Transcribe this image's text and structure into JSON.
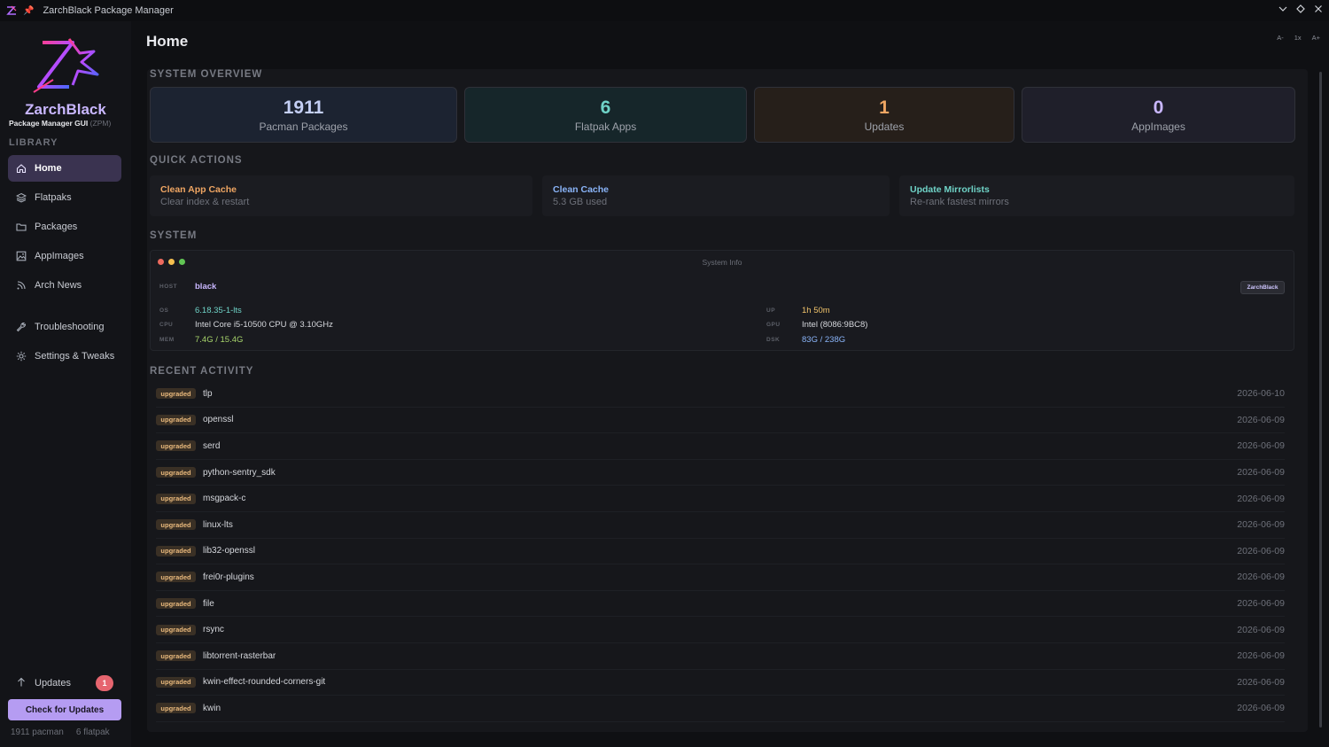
{
  "window": {
    "title": "ZarchBlack Package Manager",
    "controls": [
      "minimize",
      "maximize",
      "close"
    ]
  },
  "sidebar": {
    "brand": "ZarchBlack",
    "subtitle": "Package Manager GUI",
    "subtitle_tag": "(ZPM)",
    "library_heading": "LIBRARY",
    "nav": [
      {
        "label": "Home",
        "icon": "home-icon",
        "active": true
      },
      {
        "label": "Flatpaks",
        "icon": "layers-icon",
        "active": false
      },
      {
        "label": "Packages",
        "icon": "folder-icon",
        "active": false
      },
      {
        "label": "AppImages",
        "icon": "image-icon",
        "active": false
      },
      {
        "label": "Arch News",
        "icon": "rss-icon",
        "active": false
      },
      {
        "label": "Troubleshooting",
        "icon": "wrench-icon",
        "active": false
      },
      {
        "label": "Settings & Tweaks",
        "icon": "gear-icon",
        "active": false
      }
    ],
    "updates_label": "Updates",
    "updates_count": "1",
    "check_button": "Check for Updates",
    "footer_pacman": "1911 pacman",
    "footer_flatpak": "6 flatpak"
  },
  "main": {
    "title": "Home",
    "zoom": {
      "decrease": "A-",
      "reset": "1x",
      "increase": "A+"
    },
    "overview": {
      "heading": "SYSTEM OVERVIEW",
      "cards": [
        {
          "value": "1911",
          "label": "Pacman Packages",
          "color": "#c4cff5"
        },
        {
          "value": "6",
          "label": "Flatpak Apps",
          "color": "#6fd3c7"
        },
        {
          "value": "1",
          "label": "Updates",
          "color": "#f0a663"
        },
        {
          "value": "0",
          "label": "AppImages",
          "color": "#c9b7ff"
        }
      ]
    },
    "quick_actions": {
      "heading": "QUICK ACTIONS",
      "items": [
        {
          "title": "Clean App Cache",
          "subtitle": "Clear index & restart",
          "color": "#f0a663"
        },
        {
          "title": "Clean Cache",
          "subtitle": "5.3 GB used",
          "color": "#8ab4f8"
        },
        {
          "title": "Update Mirrorlists",
          "subtitle": "Re-rank fastest mirrors",
          "color": "#6fd3c7"
        }
      ]
    },
    "system": {
      "heading": "SYSTEM",
      "window_title": "System Info",
      "tag": "ZarchBlack",
      "host": {
        "key": "HOST",
        "value": "black"
      },
      "os": {
        "key": "OS",
        "value": "6.18.35-1-lts"
      },
      "cpu": {
        "key": "CPU",
        "value": "Intel Core i5-10500 CPU @ 3.10GHz"
      },
      "mem": {
        "key": "MEM",
        "value": "7.4G / 15.4G"
      },
      "up": {
        "key": "UP",
        "value": "1h 50m"
      },
      "gpu": {
        "key": "GPU",
        "value": "Intel (8086:9BC8)"
      },
      "dsk": {
        "key": "DSK",
        "value": "83G / 238G"
      }
    },
    "activity": {
      "heading": "RECENT ACTIVITY",
      "rows": [
        {
          "status": "upgraded",
          "name": "tlp",
          "date": "2026-06-10"
        },
        {
          "status": "upgraded",
          "name": "openssl",
          "date": "2026-06-09"
        },
        {
          "status": "upgraded",
          "name": "serd",
          "date": "2026-06-09"
        },
        {
          "status": "upgraded",
          "name": "python-sentry_sdk",
          "date": "2026-06-09"
        },
        {
          "status": "upgraded",
          "name": "msgpack-c",
          "date": "2026-06-09"
        },
        {
          "status": "upgraded",
          "name": "linux-lts",
          "date": "2026-06-09"
        },
        {
          "status": "upgraded",
          "name": "lib32-openssl",
          "date": "2026-06-09"
        },
        {
          "status": "upgraded",
          "name": "frei0r-plugins",
          "date": "2026-06-09"
        },
        {
          "status": "upgraded",
          "name": "file",
          "date": "2026-06-09"
        },
        {
          "status": "upgraded",
          "name": "rsync",
          "date": "2026-06-09"
        },
        {
          "status": "upgraded",
          "name": "libtorrent-rasterbar",
          "date": "2026-06-09"
        },
        {
          "status": "upgraded",
          "name": "kwin-effect-rounded-corners-git",
          "date": "2026-06-09"
        },
        {
          "status": "upgraded",
          "name": "kwin",
          "date": "2026-06-09"
        }
      ]
    }
  }
}
